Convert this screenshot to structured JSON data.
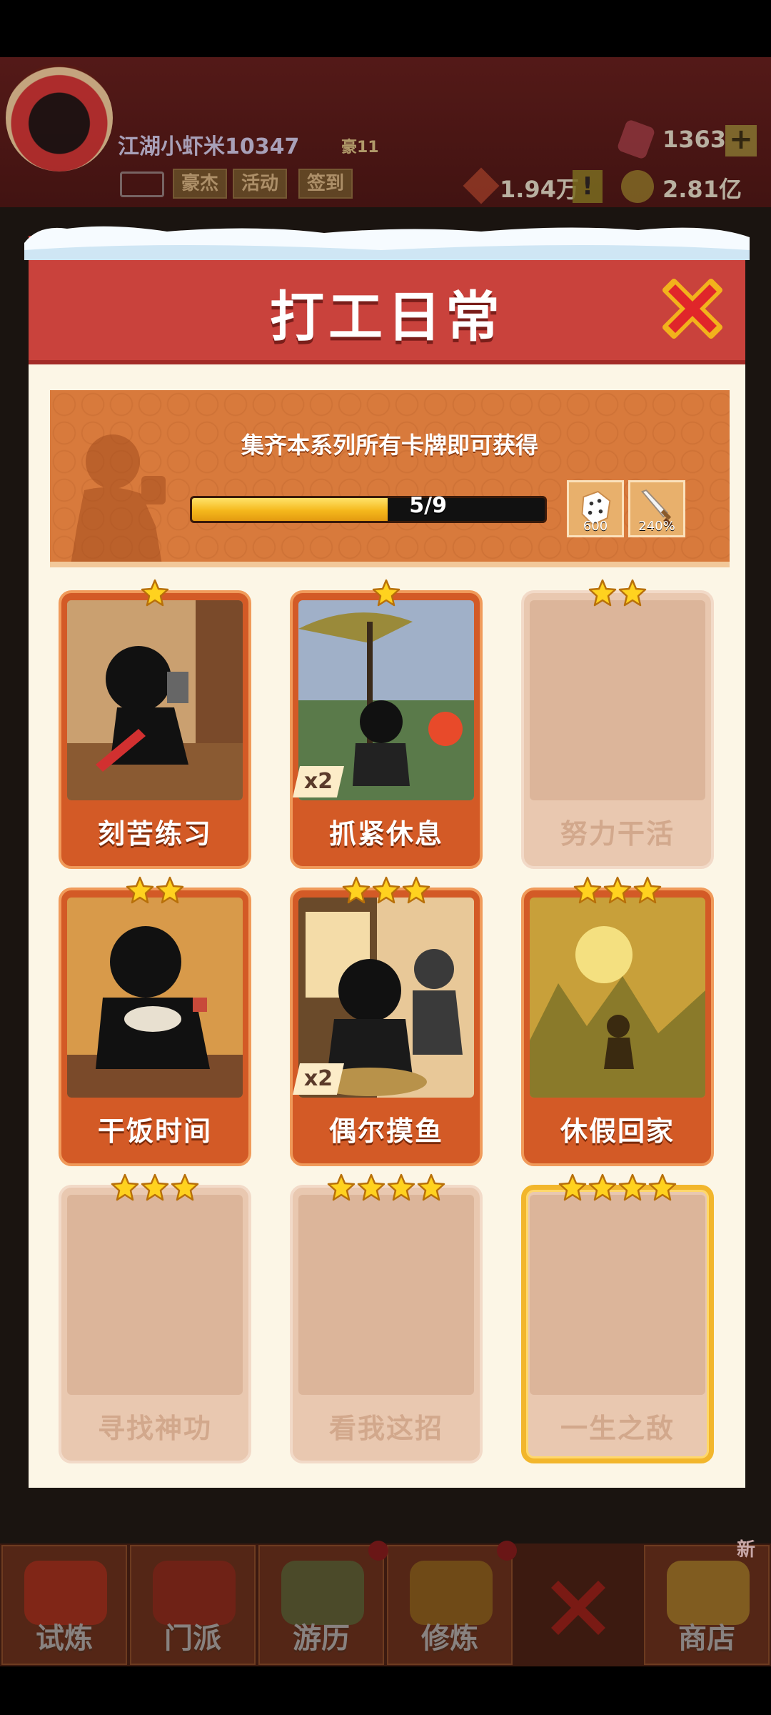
{
  "header": {
    "player_name": "江湖小虾米10347",
    "player_rank": "豪11",
    "tabs": [
      "豪杰",
      "活动",
      "签到"
    ],
    "gems": "1363",
    "power": "1.94万",
    "coins": "2.81亿",
    "warn": "!",
    "plus": "+"
  },
  "modal": {
    "title": "打工日常",
    "banner_text": "集齐本系列所有卡牌即可获得",
    "progress": {
      "current": 5,
      "total": 9,
      "label": "5/9"
    },
    "rewards": [
      {
        "icon": "dice-icon",
        "value": "600"
      },
      {
        "icon": "sword-icon",
        "value": "240%"
      }
    ],
    "cards": [
      {
        "name": "刻苦练习",
        "stars": 1,
        "owned": true,
        "multiplier": ""
      },
      {
        "name": "抓紧休息",
        "stars": 1,
        "owned": true,
        "multiplier": "x2"
      },
      {
        "name": "努力干活",
        "stars": 2,
        "owned": false,
        "multiplier": ""
      },
      {
        "name": "干饭时间",
        "stars": 2,
        "owned": true,
        "multiplier": ""
      },
      {
        "name": "偶尔摸鱼",
        "stars": 3,
        "owned": true,
        "multiplier": "x2"
      },
      {
        "name": "休假回家",
        "stars": 3,
        "owned": true,
        "multiplier": ""
      },
      {
        "name": "寻找神功",
        "stars": 3,
        "owned": false,
        "multiplier": ""
      },
      {
        "name": "看我这招",
        "stars": 4,
        "owned": false,
        "multiplier": ""
      },
      {
        "name": "一生之敌",
        "stars": 4,
        "owned": false,
        "multiplier": ""
      }
    ]
  },
  "bottom_nav": [
    {
      "label": "试炼"
    },
    {
      "label": "门派"
    },
    {
      "label": "游历"
    },
    {
      "label": "修炼"
    },
    {
      "label": ""
    },
    {
      "label": "商店"
    }
  ],
  "new_tag": "新"
}
